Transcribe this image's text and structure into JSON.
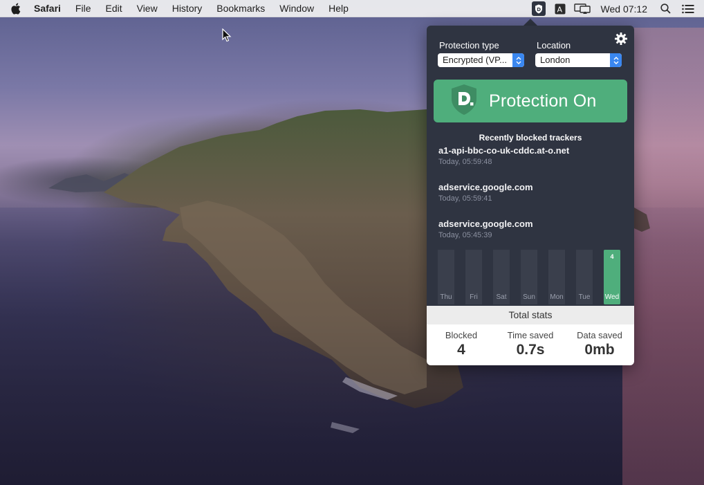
{
  "menubar": {
    "app_name": "Safari",
    "items": [
      "File",
      "Edit",
      "View",
      "History",
      "Bookmarks",
      "Window",
      "Help"
    ],
    "clock": "Wed 07:12",
    "status_icons": [
      "disconnect-shield-icon",
      "text-input-icon",
      "airplay-display-icon",
      "spotlight-search-icon",
      "notification-center-icon"
    ]
  },
  "popover": {
    "protection_type_label": "Protection type",
    "protection_type_value": "Encrypted (VP...",
    "location_label": "Location",
    "location_value": "London",
    "protection_button": "Protection On",
    "trackers_heading": "Recently blocked trackers",
    "trackers": [
      {
        "domain": "a1-api-bbc-co-uk-cddc.at-o.net",
        "time": "Today, 05:59:48"
      },
      {
        "domain": "adservice.google.com",
        "time": "Today, 05:59:41"
      },
      {
        "domain": "adservice.google.com",
        "time": "Today, 05:45:39"
      }
    ],
    "stats": {
      "title": "Total stats",
      "blocked_label": "Blocked",
      "blocked_value": "4",
      "time_label": "Time saved",
      "time_value": "0.7s",
      "data_label": "Data saved",
      "data_value": "0mb"
    }
  },
  "colors": {
    "popover_bg": "#2f3441",
    "accent_green": "#4fae7c",
    "select_blue": "#3a87f0"
  },
  "chart_data": {
    "type": "bar",
    "categories": [
      "Thu",
      "Fri",
      "Sat",
      "Sun",
      "Mon",
      "Tue",
      "Wed"
    ],
    "values": [
      0,
      0,
      0,
      0,
      0,
      0,
      4
    ],
    "data_labels": [
      "",
      "",
      "",
      "",
      "",
      "",
      "4"
    ],
    "highlight": "Wed",
    "title": "",
    "xlabel": "",
    "ylabel": "",
    "ylim": [
      0,
      4
    ],
    "grid": false
  }
}
